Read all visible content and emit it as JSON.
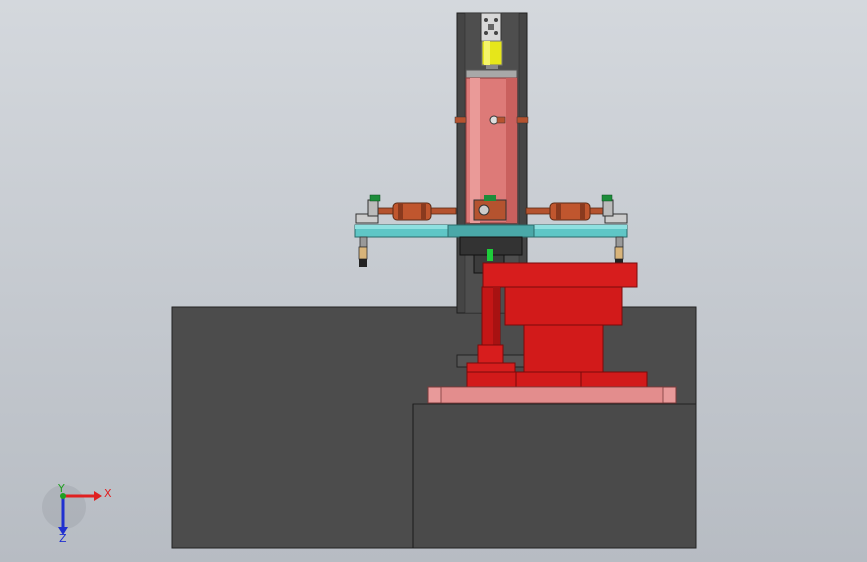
{
  "viewport": {
    "background_top": "#d4d8dd",
    "background_bottom": "#b7bcc3"
  },
  "colors": {
    "base_block": "#4c4c4c",
    "column": "#4a4a4a",
    "cylinder": "#dd7a78",
    "red_parts": "#d71d1d",
    "pink_plate": "#e89a9a",
    "cyan_bar": "#5fc6c6",
    "yellow_part": "#e6e61a",
    "copper": "#b5532f",
    "green_part": "#1d8c3a"
  },
  "triad": {
    "x_label": "X",
    "y_label": "Y",
    "z_label": "Z",
    "x_color": "#e02020",
    "y_color": "#20a020",
    "z_color": "#2030d0"
  }
}
